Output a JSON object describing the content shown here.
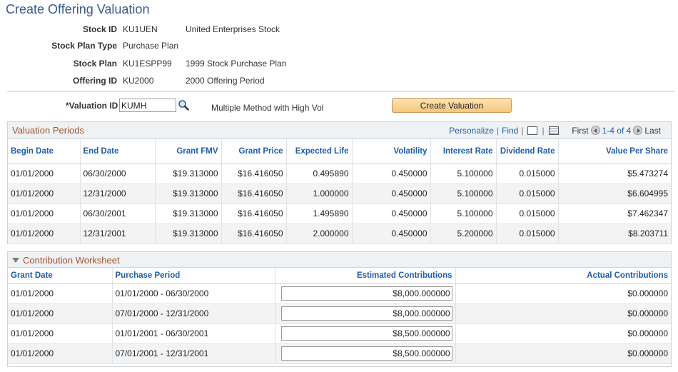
{
  "page": {
    "title": "Create Offering Valuation"
  },
  "header": [
    {
      "label": "Stock ID",
      "value": "KU1UEN",
      "desc": "United Enterprises Stock"
    },
    {
      "label": "Stock Plan Type",
      "value": "Purchase Plan",
      "desc": ""
    },
    {
      "label": "Stock Plan",
      "value": "KU1ESPP99",
      "desc": "1999 Stock Purchase Plan"
    },
    {
      "label": "Offering ID",
      "value": "KU2000",
      "desc": "2000 Offering Period"
    }
  ],
  "valuation": {
    "label": "*Valuation ID",
    "value": "KUMH",
    "desc": "Multiple Method with High Vol",
    "button": "Create Valuation"
  },
  "valuation_periods": {
    "title": "Valuation Periods",
    "nav": {
      "personalize": "Personalize",
      "find": "Find",
      "first": "First",
      "range": "1-4 of 4",
      "last": "Last"
    },
    "columns": [
      "Begin Date",
      "End Date",
      "Grant FMV",
      "Grant Price",
      "Expected Life",
      "Volatility",
      "Interest Rate",
      "Dividend Rate",
      "Value Per Share"
    ],
    "rows": [
      [
        "01/01/2000",
        "06/30/2000",
        "$19.313000",
        "$16.416050",
        "0.495890",
        "0.450000",
        "5.100000",
        "0.015000",
        "$5.473274"
      ],
      [
        "01/01/2000",
        "12/31/2000",
        "$19.313000",
        "$16.416050",
        "1.000000",
        "0.450000",
        "5.100000",
        "0.015000",
        "$6.604995"
      ],
      [
        "01/01/2000",
        "06/30/2001",
        "$19.313000",
        "$16.416050",
        "1.495890",
        "0.450000",
        "5.100000",
        "0.015000",
        "$7.462347"
      ],
      [
        "01/01/2000",
        "12/31/2001",
        "$19.313000",
        "$16.416050",
        "2.000000",
        "0.450000",
        "5.200000",
        "0.015000",
        "$8.203711"
      ]
    ]
  },
  "contribution": {
    "title": "Contribution Worksheet",
    "columns": [
      "Grant Date",
      "Purchase Period",
      "Estimated Contributions",
      "Actual Contributions"
    ],
    "rows": [
      [
        "01/01/2000",
        "01/01/2000 - 06/30/2000",
        "$8,000.000000",
        "$0.000000"
      ],
      [
        "01/01/2000",
        "07/01/2000 - 12/31/2000",
        "$8,000.000000",
        "$0.000000"
      ],
      [
        "01/01/2000",
        "01/01/2001 - 06/30/2001",
        "$8,500.000000",
        "$0.000000"
      ],
      [
        "01/01/2000",
        "07/01/2001 - 12/31/2001",
        "$8,500.000000",
        "$0.000000"
      ]
    ]
  },
  "colors": {
    "title": "#3b5a8a",
    "grid_title": "#a3522a",
    "link": "#1f5ea8",
    "button": "#f6c77c"
  },
  "icons": {
    "lookup": "magnifier-icon",
    "zoom": "view-all-icon",
    "download": "download-grid-icon",
    "first": "arrow-left-icon",
    "last": "arrow-right-icon",
    "collapse": "collapse-triangle-icon"
  }
}
